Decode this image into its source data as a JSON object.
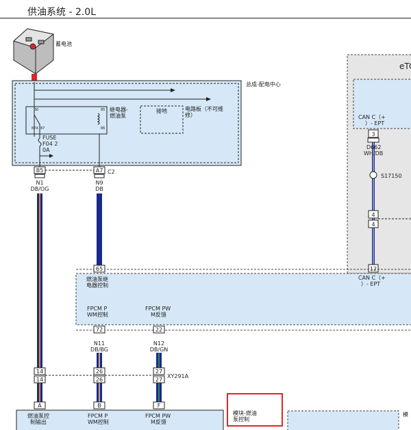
{
  "page": {
    "title": "供油系统 - 2.0L"
  },
  "battery": {
    "label": "蓄电池"
  },
  "pdc": {
    "label": "总成-配电中心",
    "relay_label_1": "继电器-",
    "relay_label_2": "燃油泵",
    "relay_pin_30": "30",
    "relay_pin_87a": "87A",
    "relay_pin_87": "87",
    "relay_pin_85": "85",
    "relay_pin_86": "86",
    "ground_label": "接地",
    "board_label_1": "电路板（不可维",
    "board_label_2": "修）",
    "fuse_line1": "FUSE",
    "fuse_line2": "F04 2",
    "fuse_line3": "0A"
  },
  "connectors": {
    "b5": "B5",
    "a7": "A7",
    "c2": "C2",
    "p65": "65",
    "p72": "72",
    "p22": "22",
    "p14": "14",
    "p26": "26",
    "p27": "27",
    "xy291a": "XY291A",
    "pa": "A",
    "pb": "B",
    "pf": "F",
    "p3": "3",
    "p4a": "4",
    "p4b": "4",
    "p12": "12"
  },
  "wires": {
    "n1_id": "N1",
    "n1_color": "DB/OG",
    "n9_id": "N9",
    "n9_color": "DB",
    "n11_id": "N11",
    "n11_color": "DB/BG",
    "n12_id": "N12",
    "n12_color": "DB/GN",
    "d662_id": "D662",
    "d662_color": "WH/DB",
    "splice": "S17150"
  },
  "etc": {
    "title": "eTC",
    "can_top_1": "CAN C（+",
    "can_top_2": "）- EPT",
    "can_bot_1": "CAN C（+",
    "can_bot_2": "）- EPT"
  },
  "fpcm_module": {
    "label_1": "燃油泵继",
    "label_2": "电器控制",
    "pwm_out_1": "FPCM P",
    "pwm_out_2": "WM控制",
    "pwm_fb_1": "FPCM PW",
    "pwm_fb_2": "M反馈"
  },
  "bottom_module": {
    "out_1": "燃油泵控",
    "out_2": "制输出",
    "pwm_1": "FPCM P",
    "pwm_2": "WM控制",
    "fb_1": "FPCM PW",
    "fb_2": "M反馈",
    "highlight_1": "模块-燃油",
    "highlight_2": "泵控制",
    "right_cut": "模"
  },
  "colors": {
    "module_fill": "#d6e8f7",
    "etc_fill": "#e6e6e6",
    "wire_db": "#1a2a8a",
    "wire_og": "#e08a1e",
    "wire_gn": "#2e8b57",
    "wire_bg": "#c9a98a",
    "highlight": "#e0252a",
    "battery_red": "#e0252a"
  }
}
